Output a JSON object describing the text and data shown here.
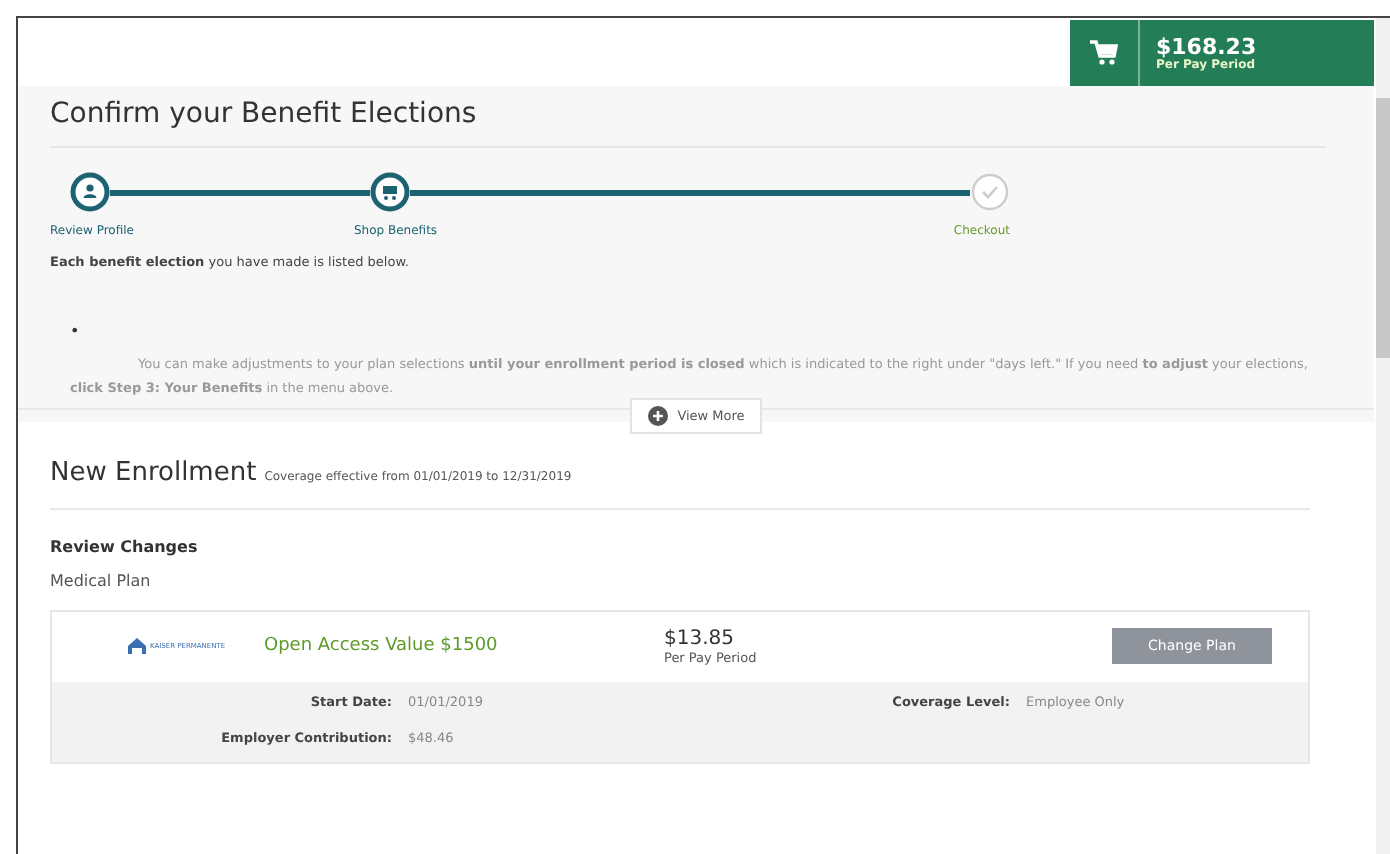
{
  "cart": {
    "total": "$168.23",
    "caption": "Per Pay Period"
  },
  "title": "Confirm your Benefit Elections",
  "steps": [
    {
      "label": "Review Profile",
      "done": true,
      "kind": "person"
    },
    {
      "label": "Shop Benefits",
      "done": true,
      "kind": "cart"
    },
    {
      "label": "Checkout",
      "done": false,
      "kind": "check"
    }
  ],
  "intro": "**Each benefit election** you have made is listed below.",
  "bullet": "•",
  "notice": "You can make adjustments to your plan selections **until your enrollment period is closed** which is indicated to the right under \"days left.\" If you need **to adjust** your elections, **click Step 3: Your Benefits** in the menu above.",
  "view_more": "View More",
  "enrollment": {
    "heading": "New Enrollment",
    "coverage": "Coverage effective from 01/01/2019 to 12/31/2019"
  },
  "review_heading": "Review Changes",
  "plan_type": "Medical Plan",
  "plan": {
    "carrier": "KAISER PERMANENTE",
    "name": "Open Access Value $1500",
    "price": "$13.85",
    "price_caption": "Per Pay Period",
    "button": "Change Plan"
  },
  "details": [
    {
      "label": "Start Date:",
      "value": "01/01/2019"
    },
    {
      "label": "Coverage Level:",
      "value": "Employee Only"
    },
    {
      "label": "Employer Contribution:",
      "value": "$48.46"
    }
  ]
}
